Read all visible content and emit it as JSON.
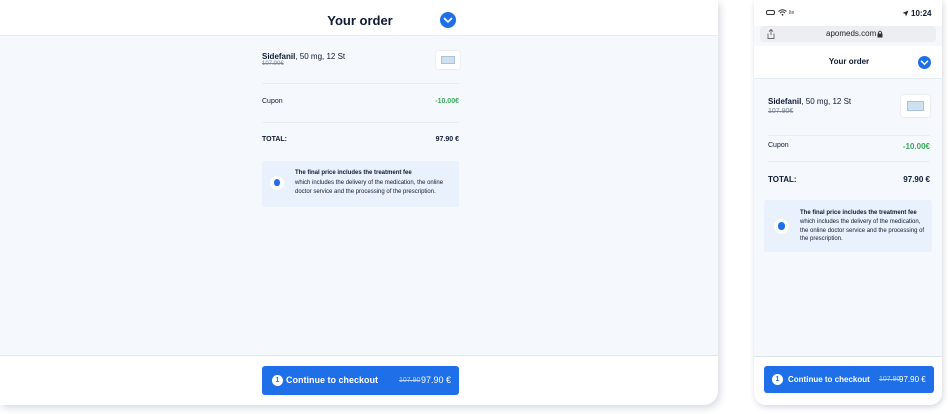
{
  "desktop": {
    "header": {
      "title": "Your order"
    },
    "product": {
      "name": "Sidefanil",
      "detail": ", 50 mg, 12 St",
      "old_price": "107.90€"
    },
    "coupon": {
      "label": "Cupon",
      "value": "-10.00€"
    },
    "total": {
      "label": "TOTAL:",
      "value": "97.90 €"
    },
    "info": {
      "title": "The final price includes the treatment fee",
      "text": "which includes the delivery of the medication, the online doctor service and the processing of the prescription."
    },
    "checkout": {
      "step": "1",
      "label": "Continue to checkout",
      "old_price": "107.90",
      "price": "97.90 €"
    }
  },
  "mobile": {
    "status_bar": {
      "time": "10:24",
      "signal": "lte"
    },
    "address_bar": {
      "url": "apomeds.com"
    },
    "header": {
      "title": "Your order"
    },
    "product": {
      "name": "Sidefanil",
      "detail": ", 50 mg, 12 St",
      "old_price": "107.90€"
    },
    "coupon": {
      "label": "Cupon",
      "value": "-10.00€"
    },
    "total": {
      "label": "TOTAL:",
      "value": "97.90 €"
    },
    "info": {
      "title": "The final price includes the treatment fee",
      "text": "which includes the delivery of the medication, the online doctor service and the processing of the prescription."
    },
    "checkout": {
      "step": "1",
      "label": "Continue to checkout",
      "old_price": "107.90",
      "price": "97.90 €"
    }
  },
  "colors": {
    "accent": "#1e6fe8",
    "discount": "#3aa85a",
    "info_bg": "#e8f1fc",
    "page_bg": "#f5f8fd"
  }
}
